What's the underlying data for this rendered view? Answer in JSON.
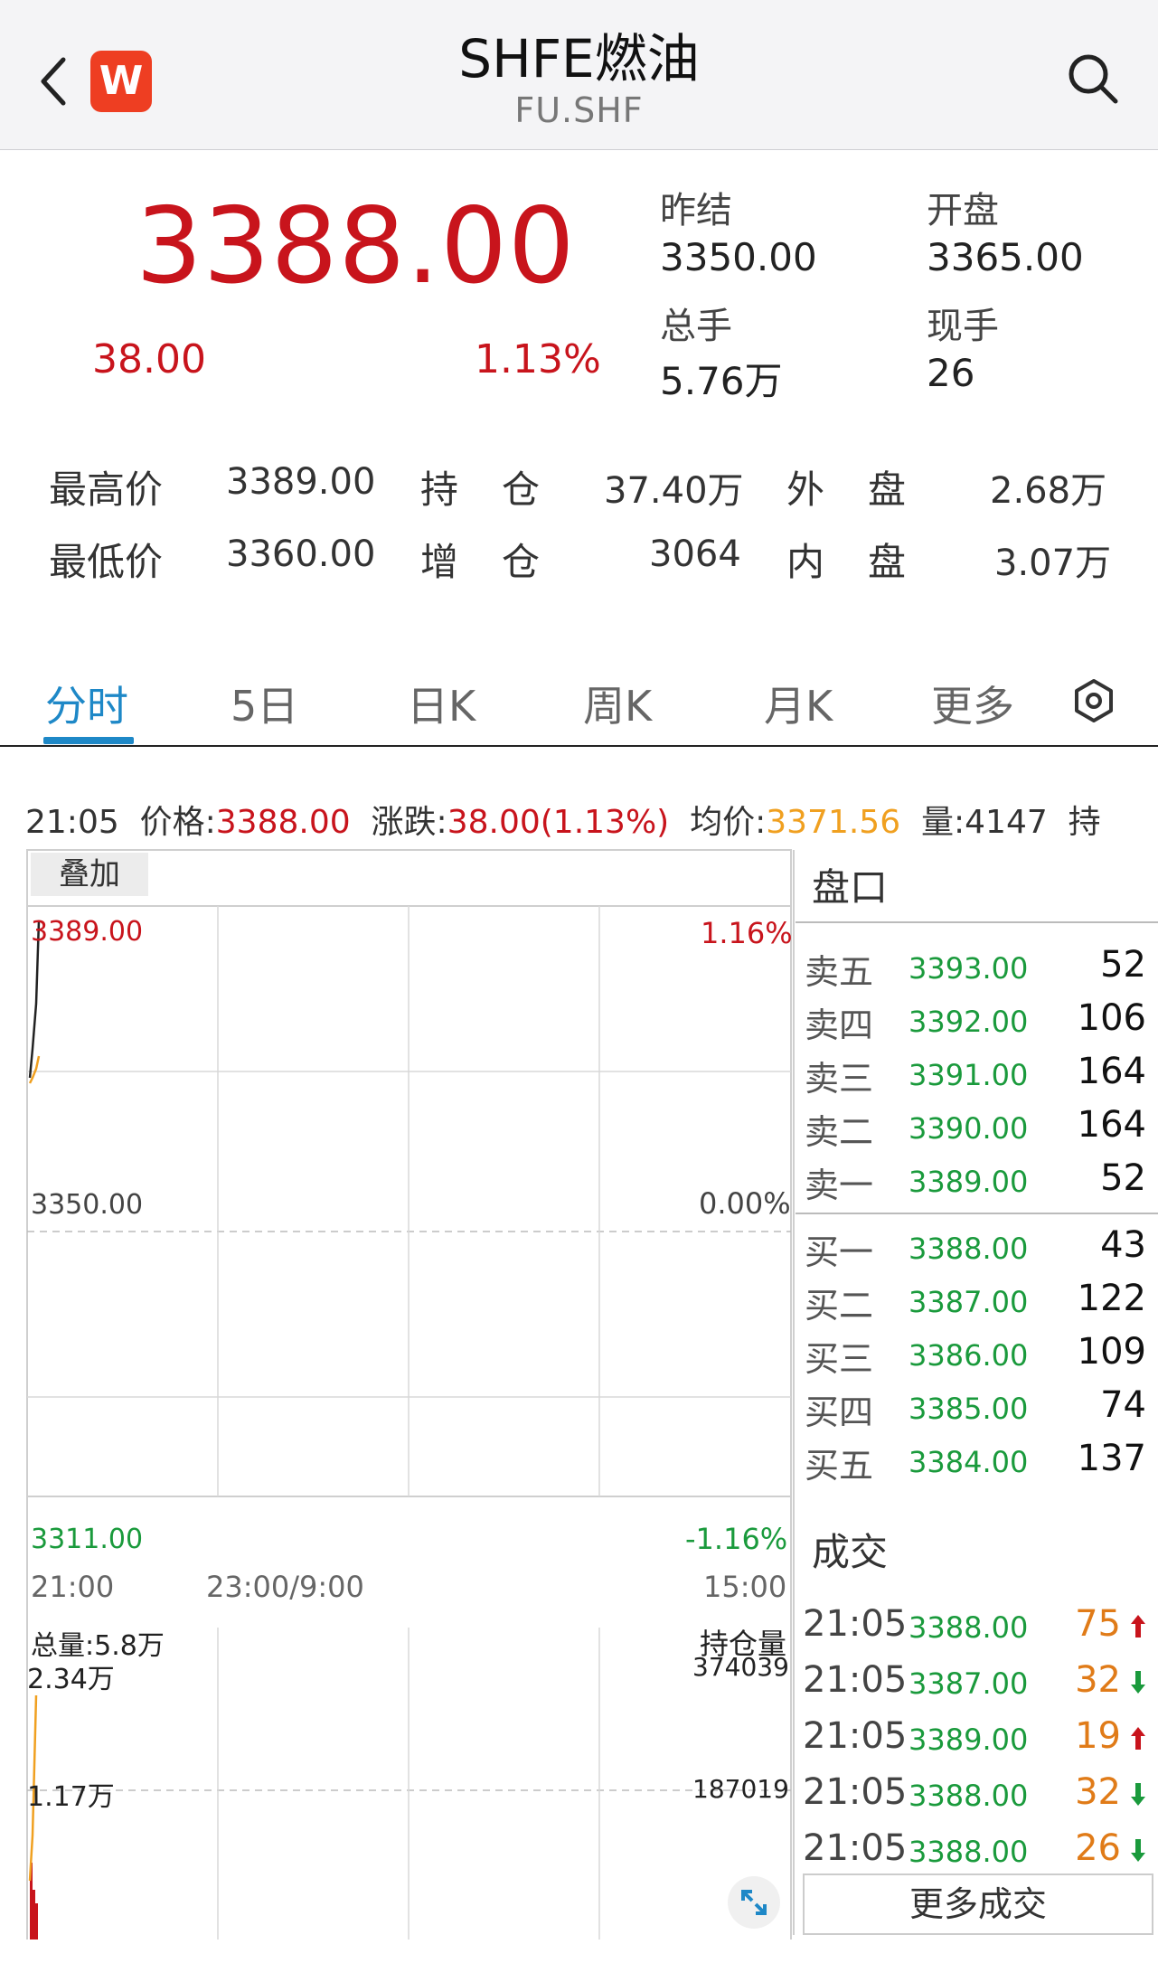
{
  "header": {
    "title": "SHFE燃油",
    "subtitle": "FU.SHF",
    "logo_letter": "W"
  },
  "quote": {
    "price": "3388.00",
    "change": "38.00",
    "change_pct": "1.13%",
    "prev_settle_label": "昨结",
    "prev_settle": "3350.00",
    "open_label": "开盘",
    "open": "3365.00",
    "total_vol_label": "总手",
    "total_vol": "5.76万",
    "cur_vol_label": "现手",
    "cur_vol": "26"
  },
  "stats": {
    "high_label": "最高价",
    "high": "3389.00",
    "low_label": "最低价",
    "low": "3360.00",
    "oi_label1": "持",
    "oi_label2": "仓",
    "oi": "37.40万",
    "oi_chg_label1": "增",
    "oi_chg_label2": "仓",
    "oi_chg": "3064",
    "outer_label1": "外",
    "outer_label2": "盘",
    "outer": "2.68万",
    "inner_label1": "内",
    "inner_label2": "盘",
    "inner": "3.07万"
  },
  "tabs": [
    "分时",
    "5日",
    "日K",
    "周K",
    "月K",
    "更多"
  ],
  "active_tab": 0,
  "infobar": {
    "time": "21:05",
    "price_label": "价格:",
    "price": "3388.00",
    "chg_label": "涨跌:",
    "chg": "38.00(1.13%)",
    "avg_label": "均价:",
    "avg": "3371.56",
    "vol_label": "量:",
    "vol": "4147",
    "hold_label": "持"
  },
  "chart": {
    "overlay_label": "叠加",
    "y_top": "3389.00",
    "y_mid": "3350.00",
    "y_bot": "3311.00",
    "pct_top": "1.16%",
    "pct_mid": "0.00%",
    "pct_bot": "-1.16%",
    "x_start": "21:00",
    "x_mid": "23:00/9:00",
    "x_end": "15:00",
    "vol_total_label": "总量:5.8万",
    "vol_top": "2.34万",
    "vol_mid": "1.17万",
    "oi_label": "持仓量",
    "oi_top": "374039",
    "oi_mid": "187019"
  },
  "orderbook": {
    "title": "盘口",
    "asks": [
      {
        "label": "卖五",
        "price": "3393.00",
        "vol": "52"
      },
      {
        "label": "卖四",
        "price": "3392.00",
        "vol": "106"
      },
      {
        "label": "卖三",
        "price": "3391.00",
        "vol": "164"
      },
      {
        "label": "卖二",
        "price": "3390.00",
        "vol": "164"
      },
      {
        "label": "卖一",
        "price": "3389.00",
        "vol": "52"
      }
    ],
    "bids": [
      {
        "label": "买一",
        "price": "3388.00",
        "vol": "43"
      },
      {
        "label": "买二",
        "price": "3387.00",
        "vol": "122"
      },
      {
        "label": "买三",
        "price": "3386.00",
        "vol": "109"
      },
      {
        "label": "买四",
        "price": "3385.00",
        "vol": "74"
      },
      {
        "label": "买五",
        "price": "3384.00",
        "vol": "137"
      }
    ]
  },
  "trades": {
    "title": "成交",
    "items": [
      {
        "time": "21:05",
        "price": "3388.00",
        "vol": "75",
        "dir": "up"
      },
      {
        "time": "21:05",
        "price": "3387.00",
        "vol": "32",
        "dir": "down"
      },
      {
        "time": "21:05",
        "price": "3389.00",
        "vol": "19",
        "dir": "up"
      },
      {
        "time": "21:05",
        "price": "3388.00",
        "vol": "32",
        "dir": "down"
      },
      {
        "time": "21:05",
        "price": "3388.00",
        "vol": "26",
        "dir": "down"
      }
    ],
    "more_label": "更多成交"
  },
  "colors": {
    "up": "#c8141c",
    "down": "#1a9a3c",
    "avg": "#f0a020",
    "tab_active": "#1e88c7"
  },
  "icons": [
    "back-icon",
    "search-icon",
    "settings-icon",
    "expand-icon",
    "arrow-up-icon",
    "arrow-down-icon"
  ]
}
